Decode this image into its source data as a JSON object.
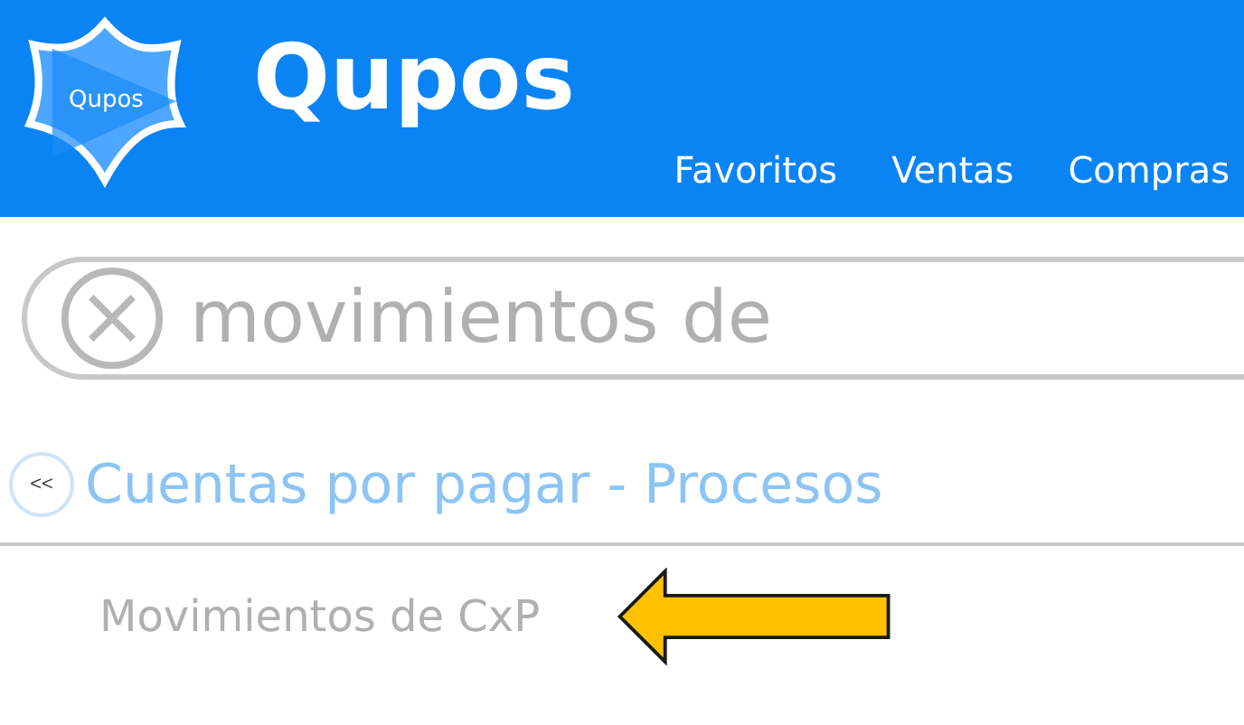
{
  "header": {
    "logo_badge": "Qupos",
    "brand": "Qupos",
    "nav": [
      {
        "label": "Favoritos"
      },
      {
        "label": "Ventas"
      },
      {
        "label": "Compras"
      }
    ]
  },
  "search": {
    "value": "movimientos de"
  },
  "section": {
    "back": "<<",
    "title": "Cuentas por pagar - Procesos"
  },
  "items": [
    {
      "label": "Movimientos de CxP",
      "pointed": true
    }
  ]
}
